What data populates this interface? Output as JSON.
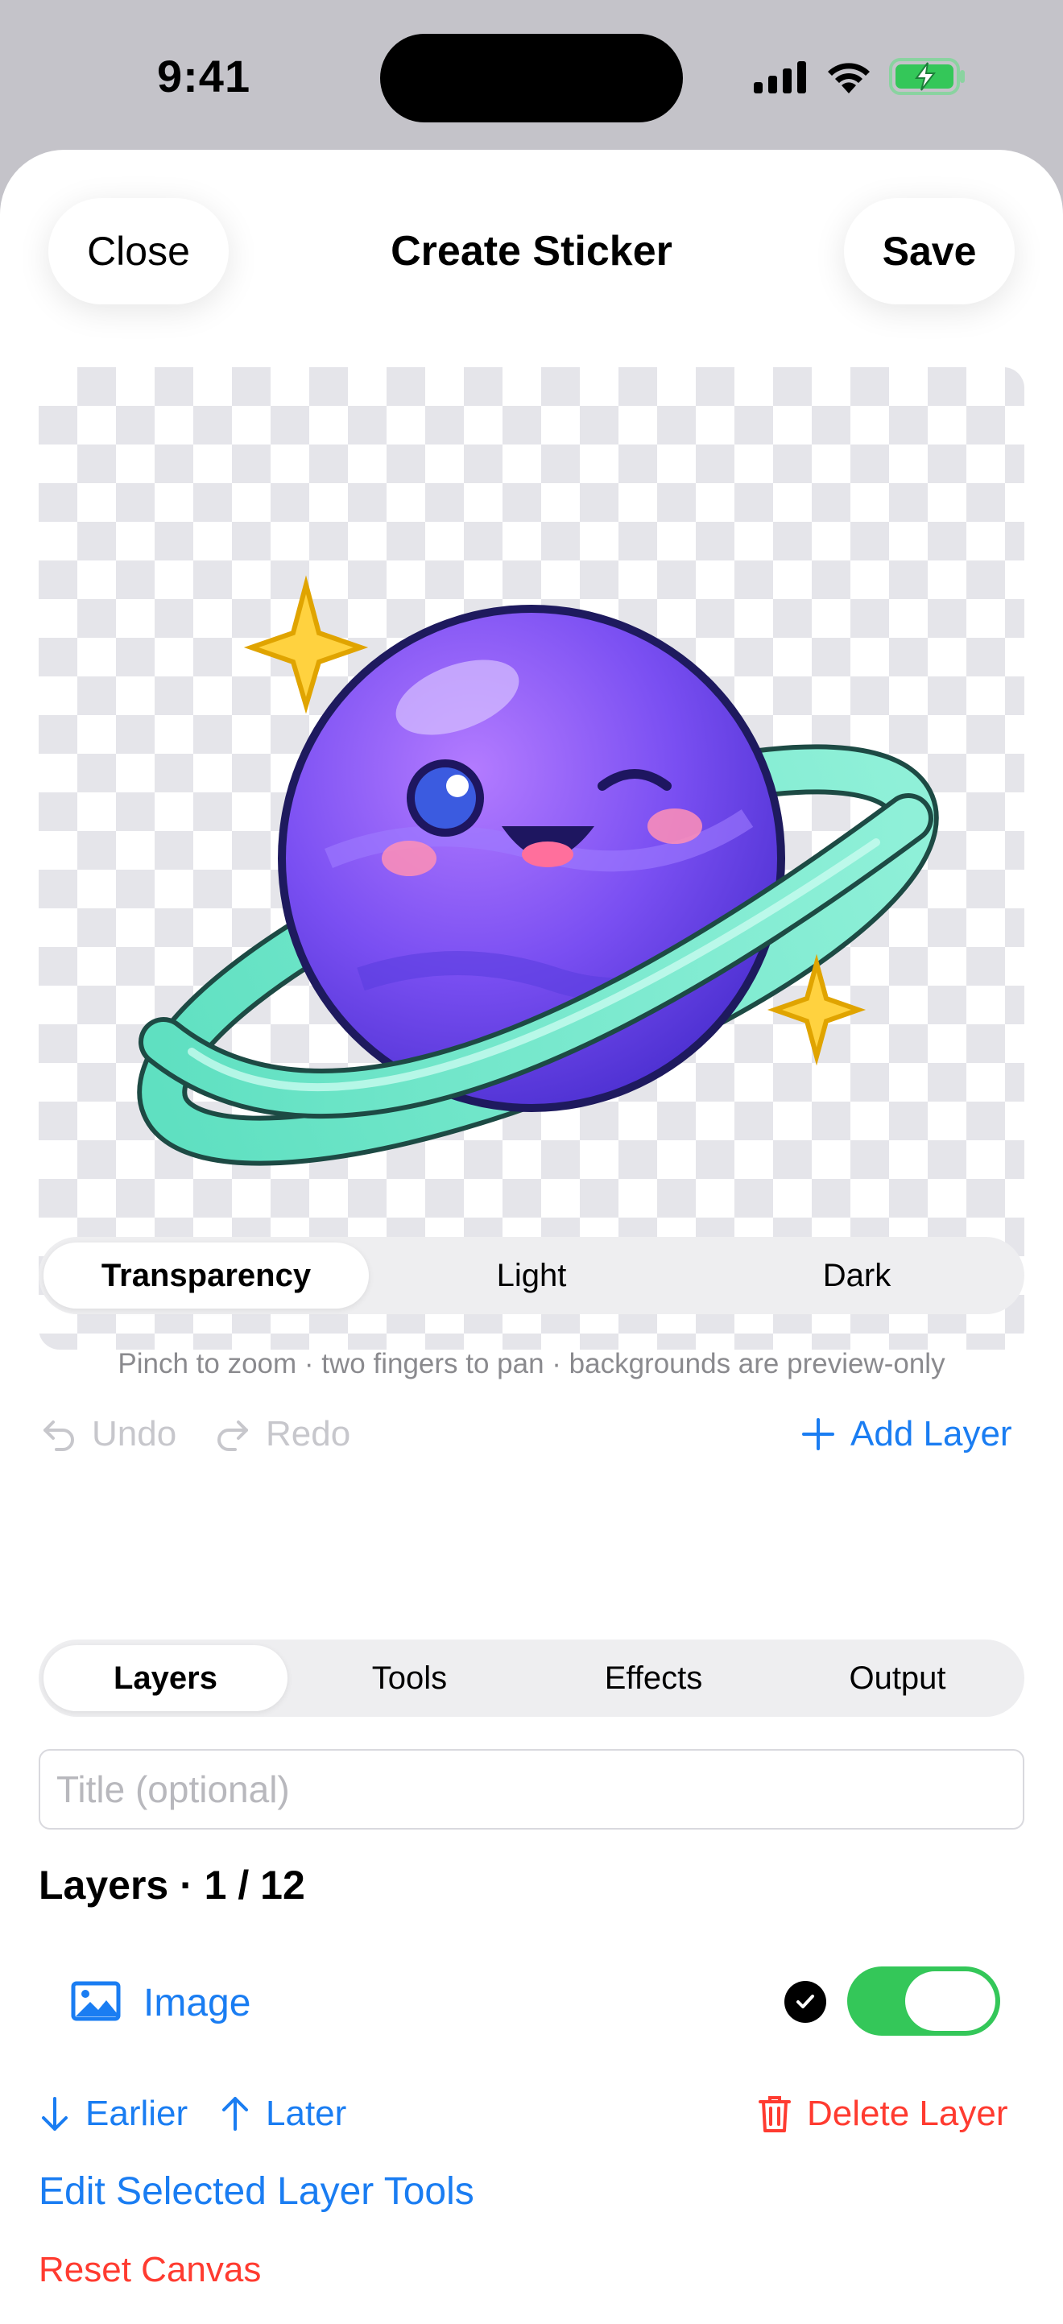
{
  "status_bar": {
    "time": "9:41"
  },
  "header": {
    "close_label": "Close",
    "title": "Create Sticker",
    "save_label": "Save"
  },
  "background_mode": {
    "options": [
      "Transparency",
      "Light",
      "Dark"
    ],
    "selected": "Transparency"
  },
  "hint": "Pinch to zoom · two fingers to pan · backgrounds are preview-only",
  "history": {
    "undo_label": "Undo",
    "redo_label": "Redo",
    "undo_enabled": false,
    "redo_enabled": false
  },
  "add_layer_label": "Add Layer",
  "tabs": {
    "items": [
      "Layers",
      "Tools",
      "Effects",
      "Output"
    ],
    "selected": "Layers"
  },
  "title_field": {
    "value": "",
    "placeholder": "Title (optional)"
  },
  "layers": {
    "heading": "Layers · 1 / 12",
    "items": [
      {
        "name": "Image",
        "selected": true,
        "visible": true
      }
    ]
  },
  "layer_actions": {
    "earlier_label": "Earlier",
    "later_label": "Later",
    "delete_label": "Delete Layer"
  },
  "edit_tools_label": "Edit Selected Layer Tools",
  "reset_label": "Reset Canvas",
  "colors": {
    "accent": "#1a7df2",
    "destructive": "#ff3b30",
    "toggle_on": "#34c759"
  }
}
